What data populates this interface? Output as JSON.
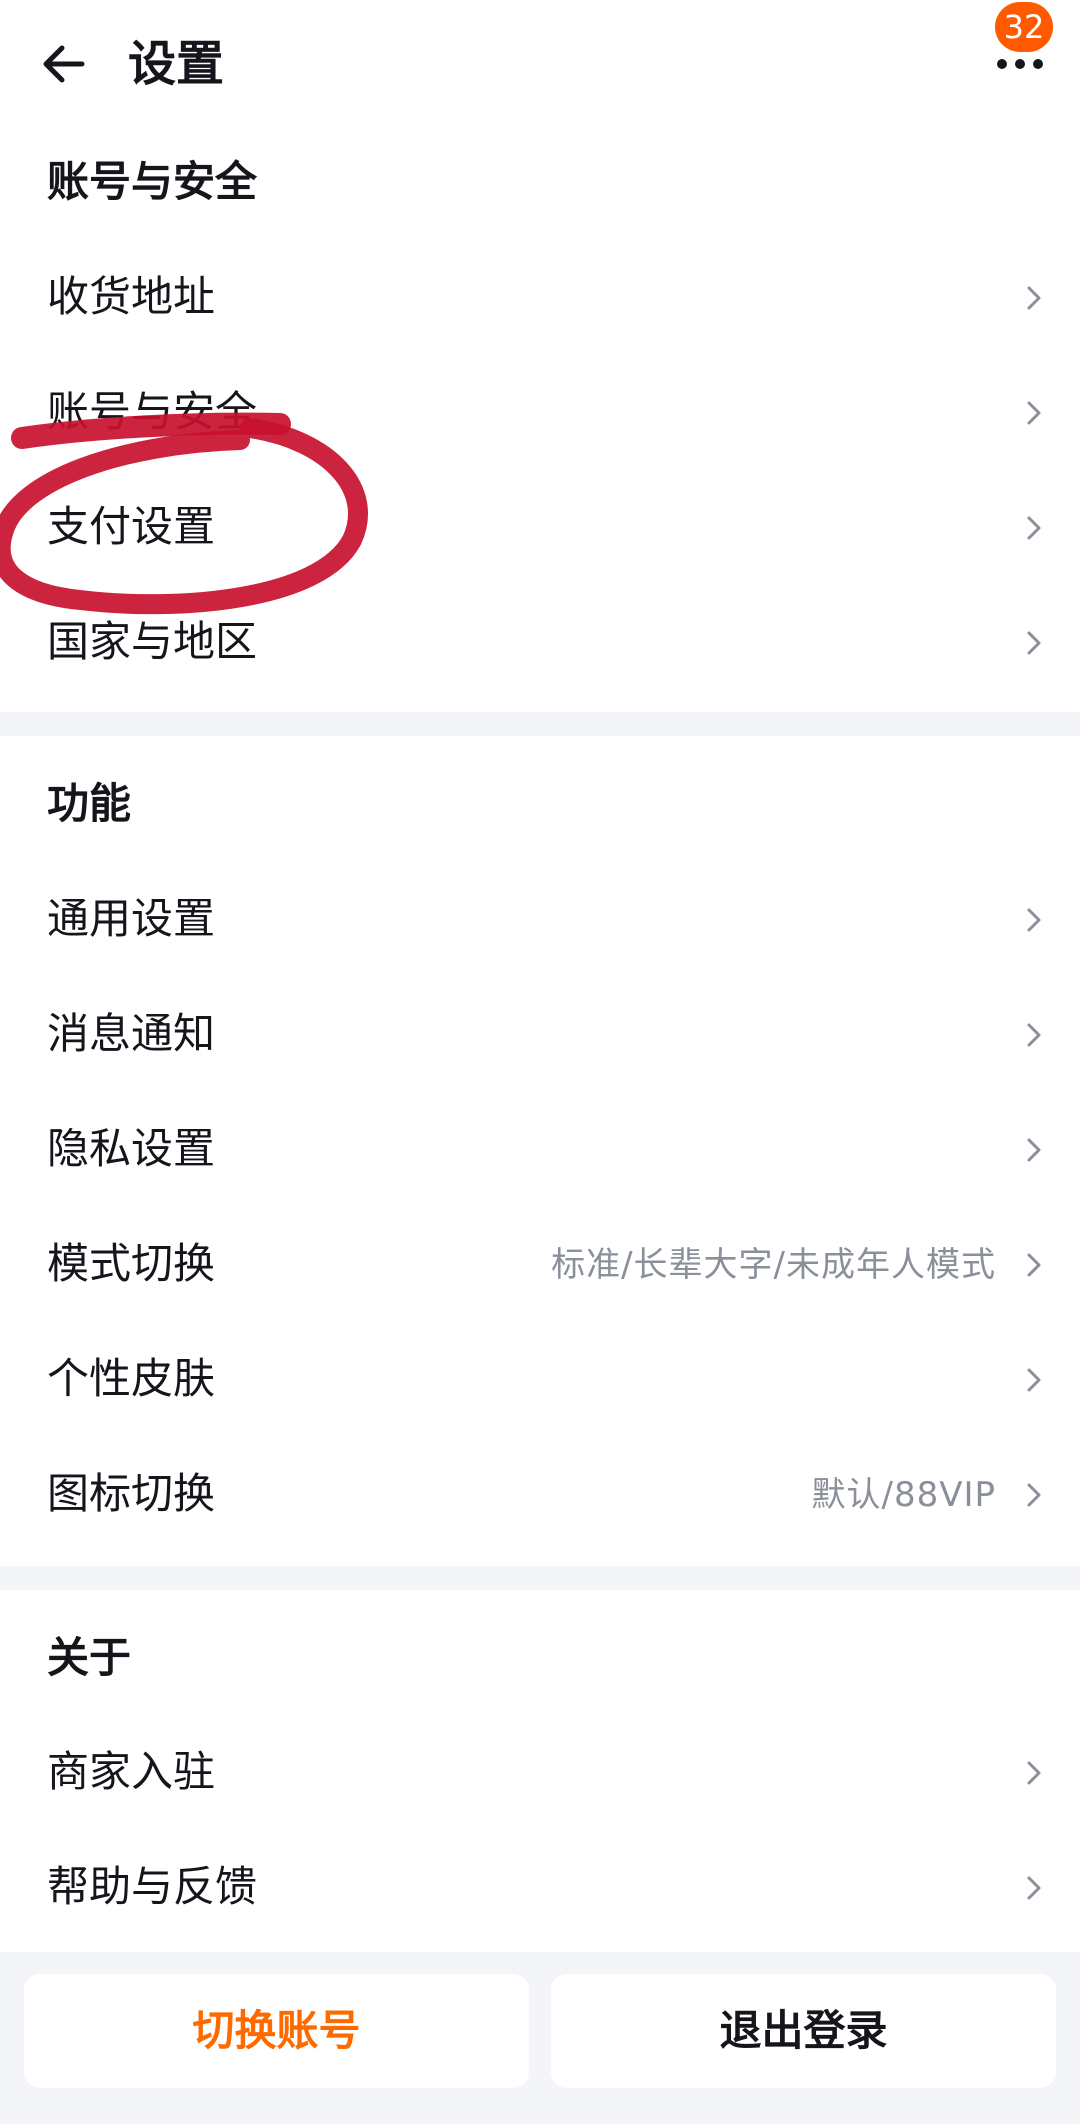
{
  "header": {
    "title": "设置",
    "back_icon": "arrow-left-icon",
    "more_icon": "more-dots-icon",
    "badge_count": "32"
  },
  "sections": [
    {
      "title": "账号与安全",
      "items": [
        {
          "label": "收货地址",
          "value": ""
        },
        {
          "label": "账号与安全",
          "value": ""
        },
        {
          "label": "支付设置",
          "value": ""
        },
        {
          "label": "国家与地区",
          "value": ""
        }
      ]
    },
    {
      "title": "功能",
      "items": [
        {
          "label": "通用设置",
          "value": ""
        },
        {
          "label": "消息通知",
          "value": ""
        },
        {
          "label": "隐私设置",
          "value": ""
        },
        {
          "label": "模式切换",
          "value": "标准/长辈大字/未成年人模式"
        },
        {
          "label": "个性皮肤",
          "value": ""
        },
        {
          "label": "图标切换",
          "value": "默认/88VIP"
        }
      ]
    },
    {
      "title": "关于",
      "items": [
        {
          "label": "商家入驻",
          "value": ""
        },
        {
          "label": "帮助与反馈",
          "value": ""
        }
      ]
    }
  ],
  "footer": {
    "switch_account": "切换账号",
    "logout": "退出登录"
  },
  "colors": {
    "accent": "#ff6a00",
    "badge": "#ff5a00",
    "annotation": "#c8102e",
    "secondary_text": "#8a8f99",
    "background": "#f3f5f8"
  }
}
